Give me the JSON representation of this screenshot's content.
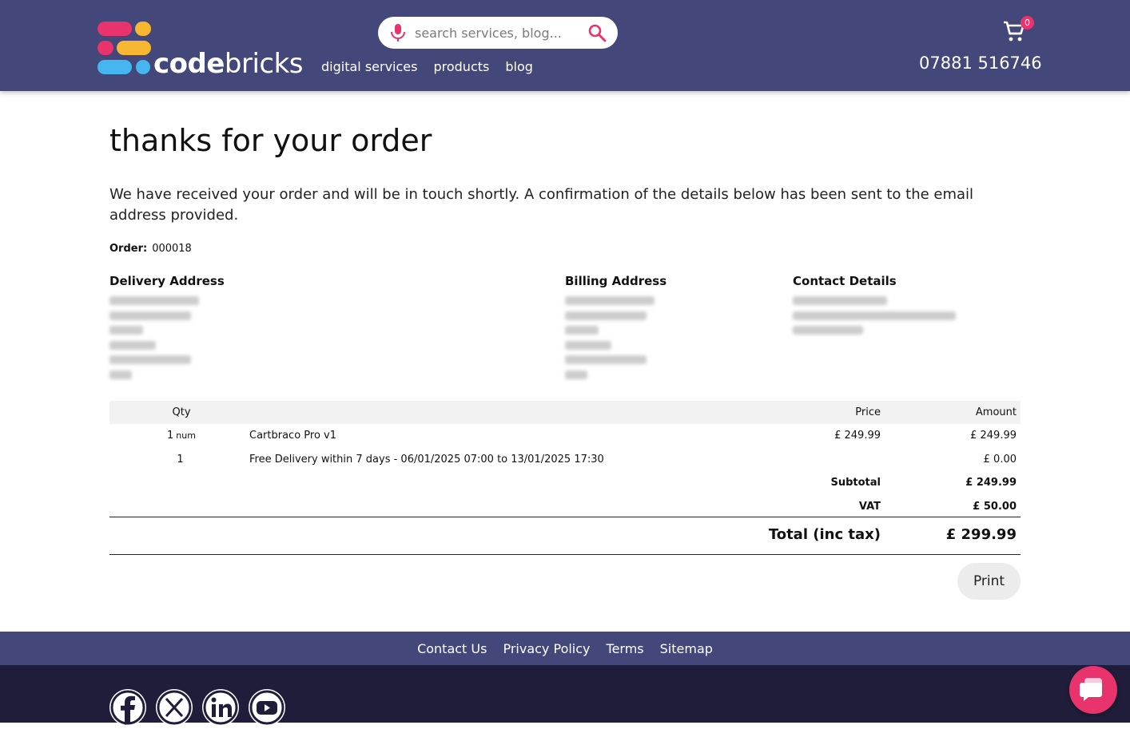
{
  "header": {
    "logo": {
      "bold_text": "code",
      "light_text": "bricks",
      "colors": {
        "pink": "#e8336d",
        "yellow": "#f7b731",
        "blue": "#45b6f0"
      }
    },
    "search": {
      "placeholder": "search services, blog..."
    },
    "nav": [
      "digital services",
      "products",
      "blog"
    ],
    "cart_count": "0",
    "phone": "07881 516746"
  },
  "main": {
    "title": "thanks for your order",
    "intro": "We have received your order and will be in touch shortly. A confirmation of the details below has been sent to the email address provided.",
    "order_label": "Order:",
    "order_number": "000018",
    "sections": [
      {
        "heading": "Delivery Address"
      },
      {
        "heading": "Billing Address"
      },
      {
        "heading": "Contact Details"
      }
    ],
    "table": {
      "headers": {
        "qty": "Qty",
        "price": "Price",
        "amount": "Amount"
      },
      "rows": [
        {
          "qty": "1",
          "unit": "num",
          "description": "Cartbraco Pro v1",
          "price": "£ 249.99",
          "amount": "£ 249.99"
        },
        {
          "qty": "1",
          "unit": "",
          "description": "Free Delivery within 7 days - 06/01/2025 07:00 to 13/01/2025 17:30",
          "price": "",
          "amount": "£ 0.00"
        }
      ],
      "subtotal_label": "Subtotal",
      "subtotal": "£ 249.99",
      "vat_label": "VAT",
      "vat": "£ 50.00",
      "total_label": "Total (inc tax)",
      "total": "£ 299.99"
    },
    "print_label": "Print"
  },
  "footer": {
    "links": [
      "Contact Us",
      "Privacy Policy",
      "Terms",
      "Sitemap"
    ],
    "social_icons": [
      "facebook-icon",
      "x-icon",
      "linkedin-icon",
      "youtube-icon"
    ]
  },
  "colors": {
    "header_bg": "#44477a",
    "footer_dark_bg": "#1f1d3a",
    "accent": "#e8336d"
  }
}
